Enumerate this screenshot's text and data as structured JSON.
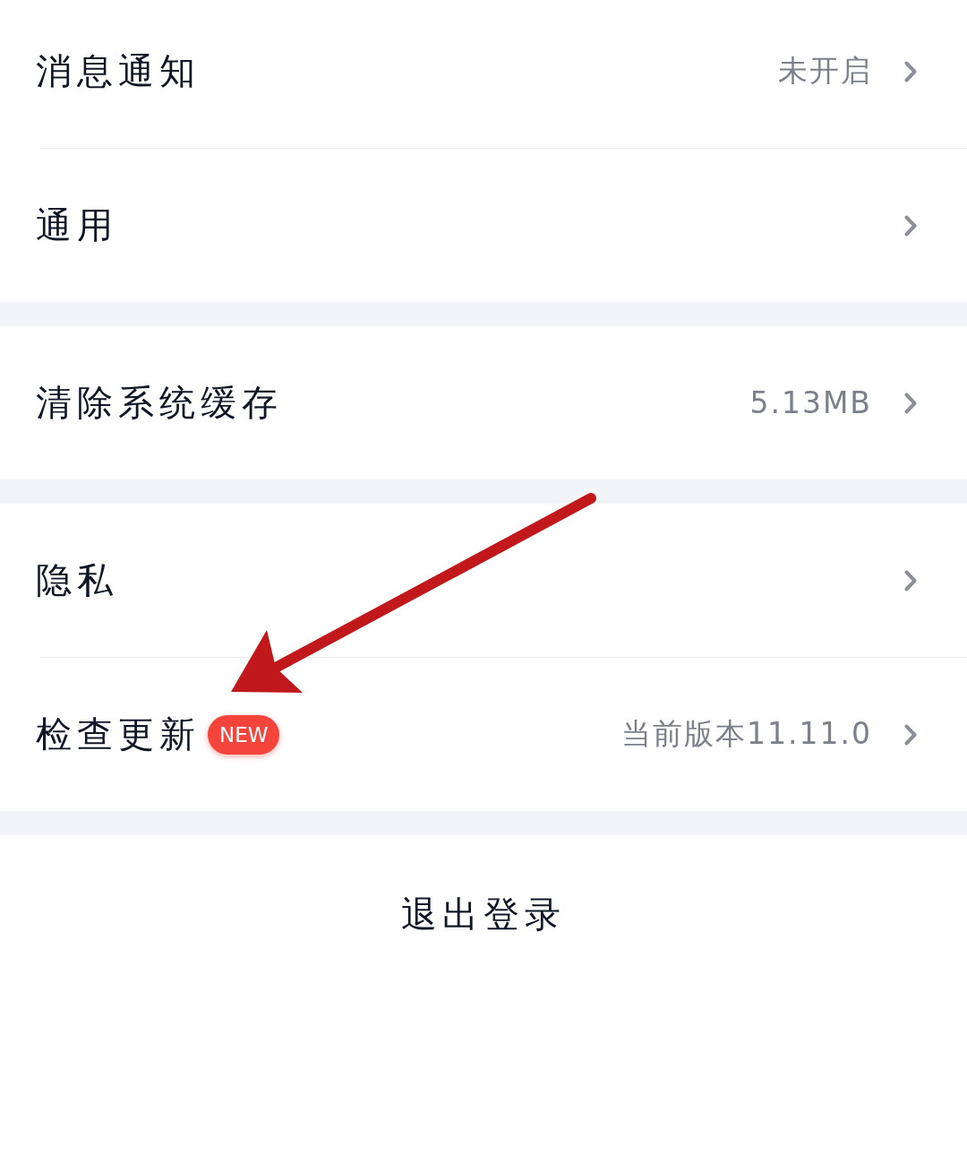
{
  "groups": [
    {
      "items": [
        {
          "label": "消息通知",
          "value": "未开启"
        },
        {
          "label": "通用"
        }
      ]
    },
    {
      "items": [
        {
          "label": "清除系统缓存",
          "value": "5.13MB"
        }
      ]
    },
    {
      "items": [
        {
          "label": "隐私"
        },
        {
          "label": "检查更新",
          "badge": "NEW",
          "value": "当前版本11.11.0"
        }
      ]
    }
  ],
  "logout": {
    "label": "退出登录"
  },
  "annotations": [
    {
      "kind": "arrow"
    }
  ]
}
